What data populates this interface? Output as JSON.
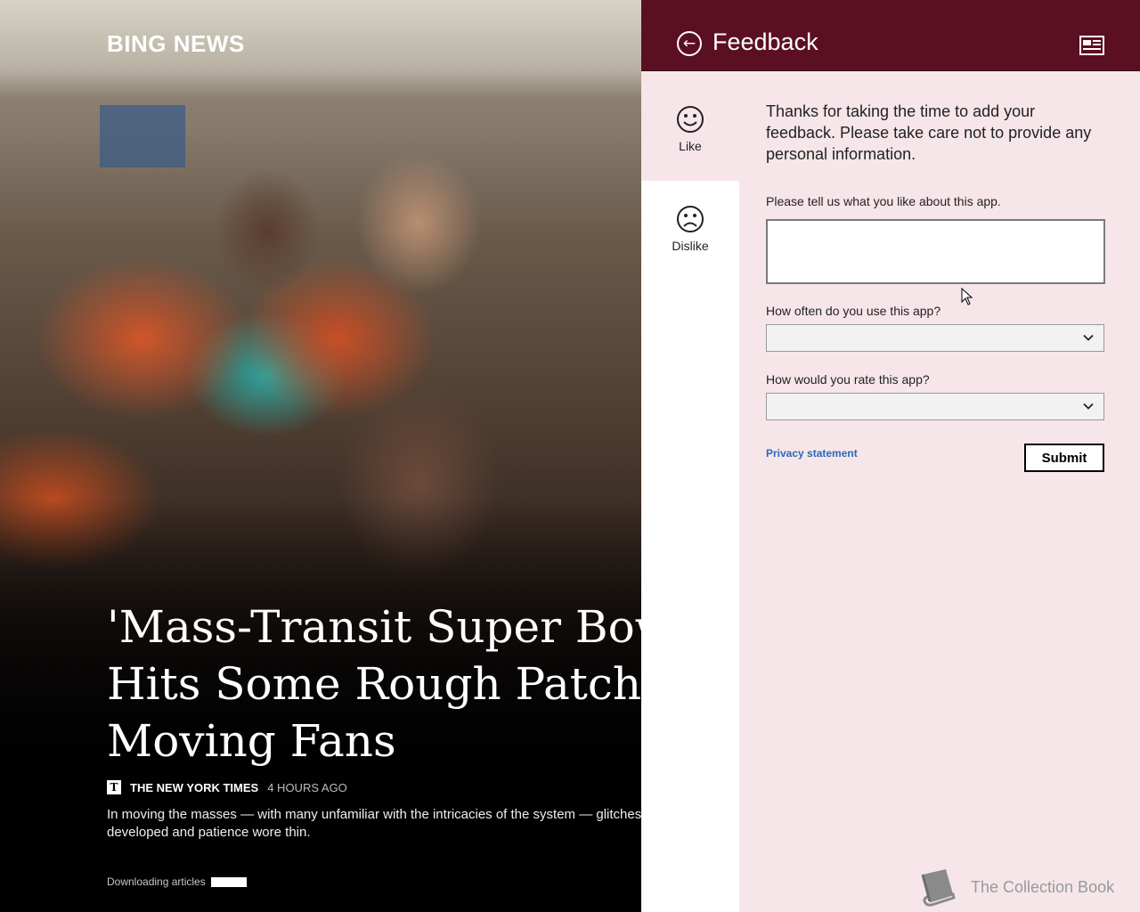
{
  "news": {
    "brand": "BING NEWS",
    "headline_lines": [
      "'Mass-Transit Super Bowl'",
      "Hits Some Rough Patches",
      "Moving Fans"
    ],
    "source_logo_glyph": "T",
    "source": "THE NEW YORK TIMES",
    "time": "4 HOURS AGO",
    "summary_lines": [
      "In moving the masses — with many unfamiliar with the intricacies of the system — glitches",
      "developed and patience wore thin."
    ],
    "downloading": "Downloading articles"
  },
  "feedback": {
    "title": "Feedback",
    "back_glyph": "←",
    "sidebar": {
      "like": "Like",
      "dislike": "Dislike",
      "selected": "Like"
    },
    "intro": "Thanks for taking the time to add your feedback. Please take care not to provide any personal information.",
    "q_like": "Please tell us what you like about this app.",
    "q_like_value": "",
    "q_frequency": "How often do you use this app?",
    "q_frequency_value": "",
    "q_rating": "How would you rate this app?",
    "q_rating_value": "",
    "privacy": "Privacy statement",
    "submit": "Submit"
  },
  "watermark": "The Collection Book",
  "colors": {
    "header": "#5b0f22",
    "panel": "#f6e6e9",
    "link": "#2a6ab8"
  }
}
